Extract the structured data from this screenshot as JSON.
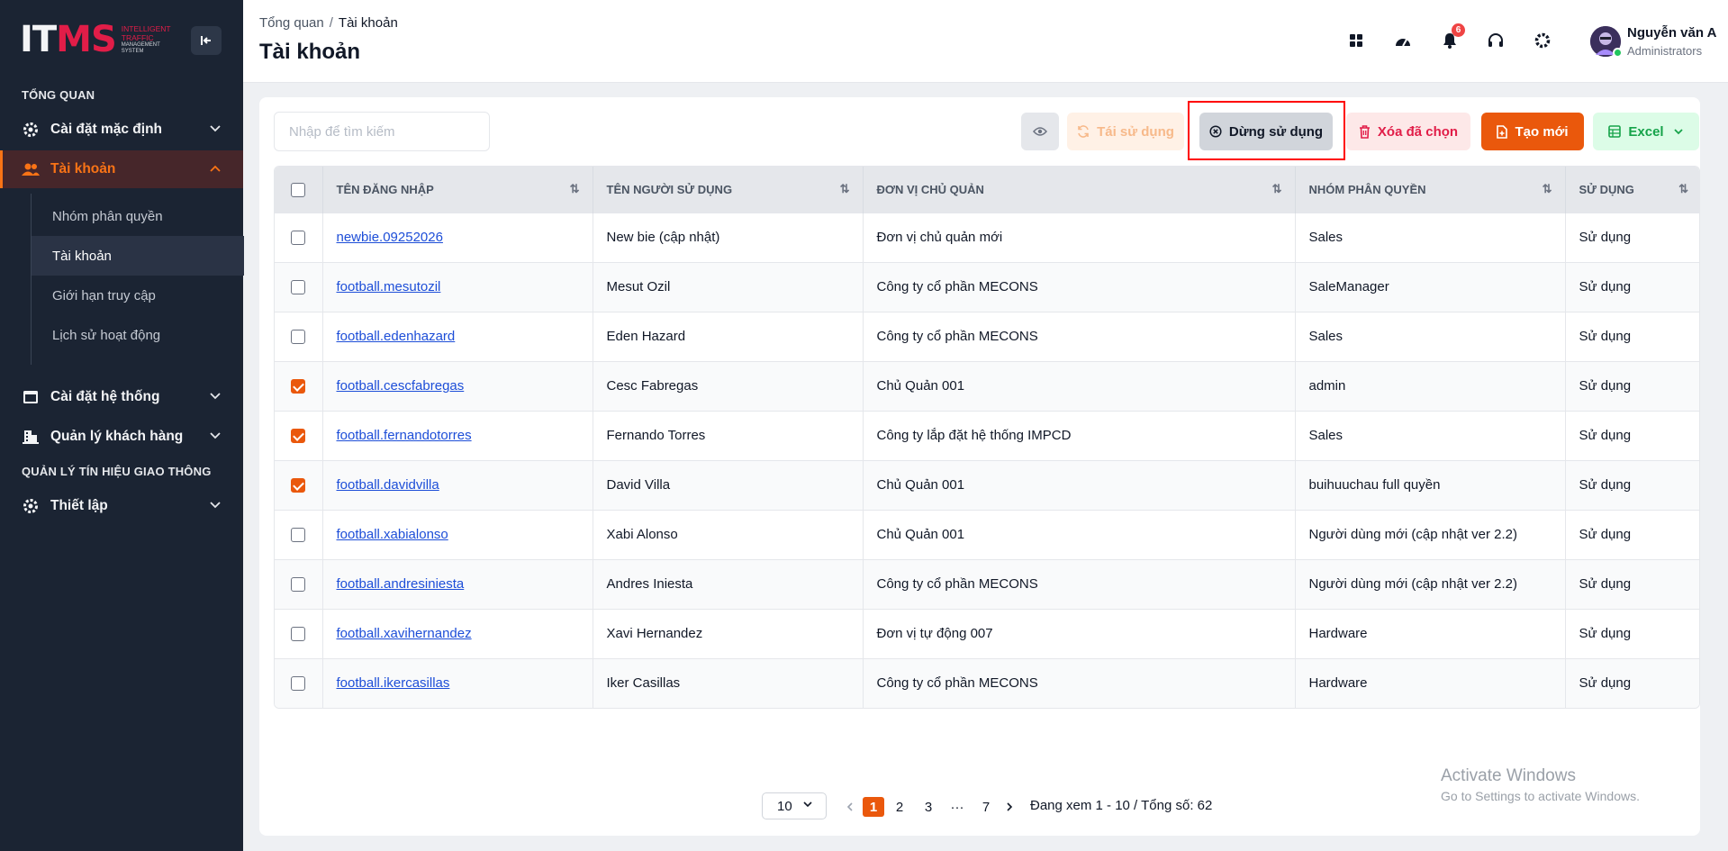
{
  "sidebar": {
    "logo": {
      "main_a": "IT",
      "main_b": "MS",
      "sub": [
        "INTELLIGENT",
        "TRAFFIC",
        "MANAGEMENT",
        "SYSTEM"
      ]
    },
    "section1": "TỔNG QUAN",
    "items": [
      {
        "label": "Cài đặt mặc định",
        "icon": "gear-icon"
      },
      {
        "label": "Tài khoản",
        "icon": "users-icon"
      }
    ],
    "sub_items": [
      "Nhóm phân quyền",
      "Tài khoản",
      "Giới hạn truy cập",
      "Lịch sử hoạt động"
    ],
    "items2": [
      {
        "label": "Cài đặt hệ thống",
        "icon": "window-icon"
      },
      {
        "label": "Quản lý khách hàng",
        "icon": "building-icon"
      }
    ],
    "section2": "QUẢN LÝ TÍN HIỆU GIAO THÔNG",
    "items3": [
      {
        "label": "Thiết lập",
        "icon": "gear-icon"
      }
    ]
  },
  "header": {
    "breadcrumb": [
      "Tổng quan",
      "Tài khoản"
    ],
    "title": "Tài khoản",
    "notif_count": "6",
    "user_name": "Nguyễn văn A",
    "user_role": "Administrators"
  },
  "toolbar": {
    "search_placeholder": "Nhập để tìm kiếm",
    "reuse": "Tái sử dụng",
    "stop": "Dừng sử dụng",
    "delete_selected": "Xóa đã chọn",
    "create_new": "Tạo mới",
    "excel": "Excel"
  },
  "table": {
    "columns": [
      "TÊN ĐĂNG NHẬP",
      "TÊN NGƯỜI SỬ DỤNG",
      "ĐƠN VỊ CHỦ QUẢN",
      "NHÓM PHÂN QUYỀN",
      "SỬ DỤNG"
    ],
    "rows": [
      {
        "checked": false,
        "username": "newbie.09252026",
        "fullname": "New bie (cập nhật)",
        "unit": "Đơn vị chủ quản mới",
        "group": "Sales",
        "status": "Sử dụng"
      },
      {
        "checked": false,
        "username": "football.mesutozil",
        "fullname": "Mesut Ozil",
        "unit": "Công ty cổ phần MECONS",
        "group": "SaleManager",
        "status": "Sử dụng"
      },
      {
        "checked": false,
        "username": "football.edenhazard",
        "fullname": "Eden Hazard",
        "unit": "Công ty cổ phần MECONS",
        "group": "Sales",
        "status": "Sử dụng"
      },
      {
        "checked": true,
        "username": "football.cescfabregas",
        "fullname": "Cesc Fabregas",
        "unit": "Chủ Quản 001",
        "group": "admin",
        "status": "Sử dụng"
      },
      {
        "checked": true,
        "username": "football.fernandotorres",
        "fullname": "Fernando Torres",
        "unit": "Công ty lắp đặt hệ thống IMPCD",
        "group": "Sales",
        "status": "Sử dụng"
      },
      {
        "checked": true,
        "username": "football.davidvilla",
        "fullname": "David Villa",
        "unit": "Chủ Quản 001",
        "group": "buihuuchau full quyền",
        "status": "Sử dụng"
      },
      {
        "checked": false,
        "username": "football.xabialonso",
        "fullname": "Xabi Alonso",
        "unit": "Chủ Quản 001",
        "group": "Người dùng mới (cập nhật ver 2.2)",
        "status": "Sử dụng"
      },
      {
        "checked": false,
        "username": "football.andresiniesta",
        "fullname": "Andres Iniesta",
        "unit": "Công ty cổ phần MECONS",
        "group": "Người dùng mới (cập nhật ver 2.2)",
        "status": "Sử dụng"
      },
      {
        "checked": false,
        "username": "football.xavihernandez",
        "fullname": "Xavi Hernandez",
        "unit": "Đơn vị tự động 007",
        "group": "Hardware",
        "status": "Sử dụng"
      },
      {
        "checked": false,
        "username": "football.ikercasillas",
        "fullname": "Iker Casillas",
        "unit": "Công ty cổ phần MECONS",
        "group": "Hardware",
        "status": "Sử dụng"
      }
    ]
  },
  "pagination": {
    "page_size": "10",
    "pages": [
      "1",
      "2",
      "3",
      "···",
      "7"
    ],
    "current": "1",
    "info": "Đang xem 1 - 10 / Tổng số: 62"
  },
  "watermark": {
    "line1": "Activate Windows",
    "line2": "Go to Settings to activate Windows."
  },
  "colors": {
    "accent": "#ea580c",
    "sidebar_bg": "#1b2433",
    "link": "#1d4ed8",
    "highlight": "#ff0000"
  }
}
